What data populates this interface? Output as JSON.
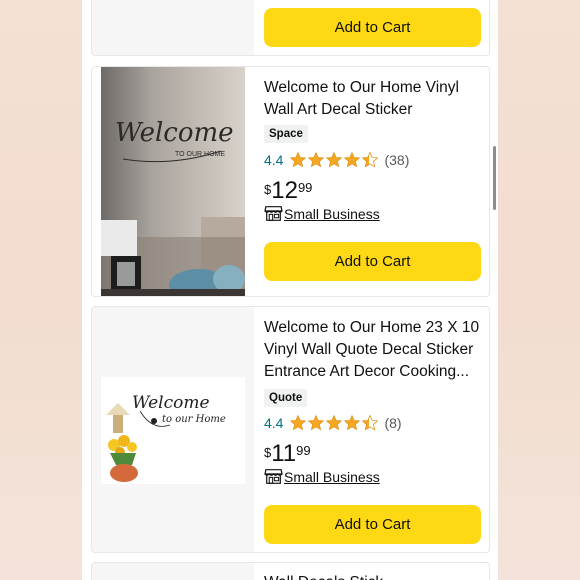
{
  "colors": {
    "button": "#ffd814",
    "star": "#f5a623",
    "rating_link": "#007185",
    "background": "#f4e0d4"
  },
  "cards": [
    {
      "add_to_cart": "Add to Cart"
    },
    {
      "title": "Welcome to Our Home Vinyl Wall Art Decal Sticker",
      "tag": "Space",
      "rating": "4.4",
      "stars": 4.4,
      "review_count": "(38)",
      "price_currency": "$",
      "price_whole": "12",
      "price_fraction": "99",
      "badge_icon": "store-icon",
      "badge": "Small Business",
      "add_to_cart": "Add to Cart",
      "image": {
        "headline": "Welcome",
        "subline": "TO OUR HOME"
      }
    },
    {
      "title": "Welcome to Our Home 23 X 10 Vinyl Wall Quote Decal Sticker Entrance Art Decor Cooking...",
      "tag": "Quote",
      "rating": "4.4",
      "stars": 4.4,
      "review_count": "(8)",
      "price_currency": "$",
      "price_whole": "11",
      "price_fraction": "99",
      "badge_icon": "store-icon",
      "badge": "Small Business",
      "add_to_cart": "Add to Cart",
      "image": {
        "headline": "Welcome",
        "subline": "to our Home"
      }
    },
    {
      "title_partial": "Wall Decals Stick..."
    }
  ]
}
